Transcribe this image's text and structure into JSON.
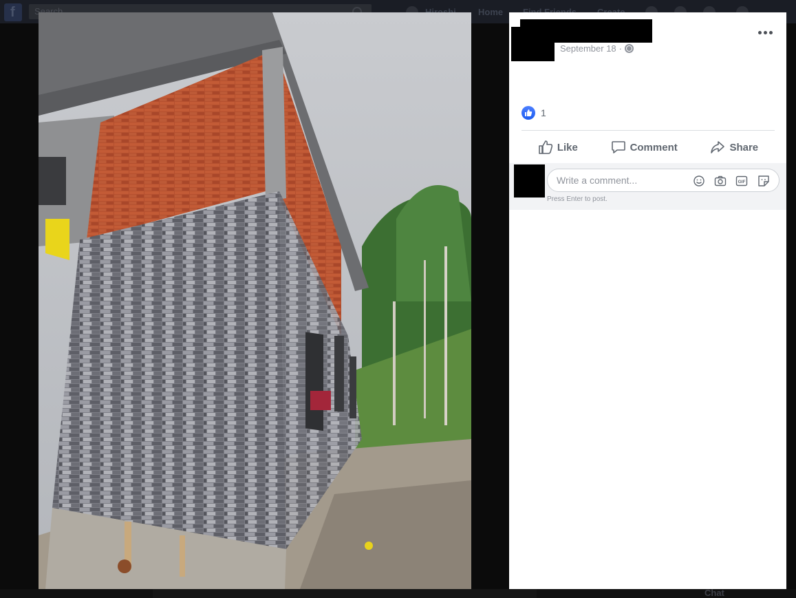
{
  "background_page": {
    "search_placeholder": "Search",
    "nav": [
      "Hiroshi",
      "Home",
      "Find Friends",
      "Create"
    ],
    "chat_label": "Chat"
  },
  "post": {
    "date": "September 18",
    "separator": "·",
    "privacy_icon": "globe-icon",
    "more_icon": "more-options-icon"
  },
  "reactions": {
    "icon": "like-reaction-icon",
    "count": "1"
  },
  "actions": {
    "like_label": "Like",
    "comment_label": "Comment",
    "share_label": "Share"
  },
  "comment_composer": {
    "placeholder": "Write a comment...",
    "hint": "Press Enter to post.",
    "icons": [
      "emoji-icon",
      "camera-icon",
      "gif-icon",
      "sticker-icon"
    ]
  },
  "colors": {
    "panel_bg": "#ffffff",
    "overlay_bg": "#0b0b0b",
    "muted_text": "#606770",
    "meta_text": "#90949c",
    "like_blue": "#1b5cf0"
  }
}
